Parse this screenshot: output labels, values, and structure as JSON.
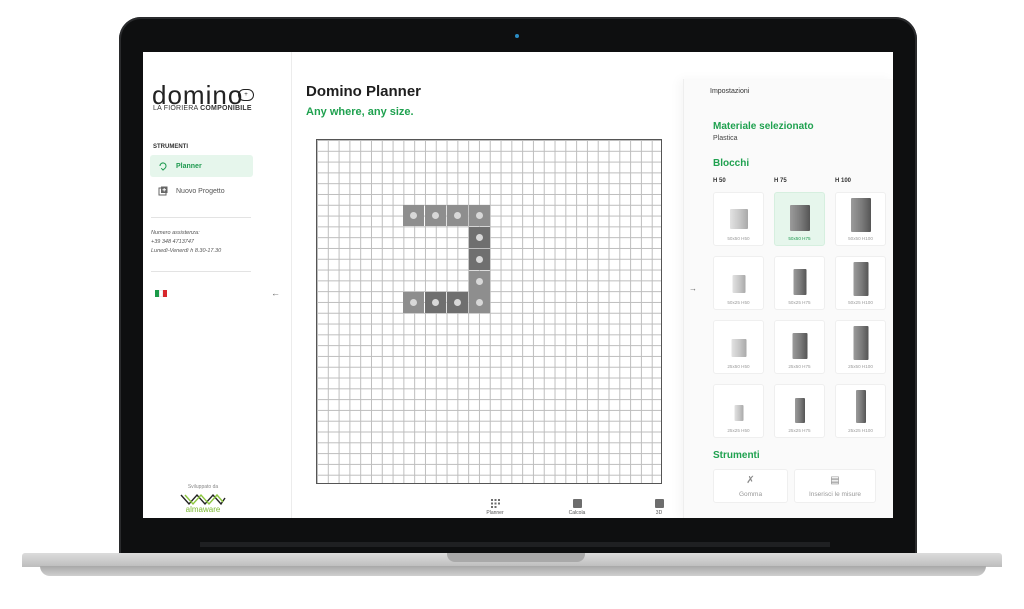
{
  "brand": {
    "logo_word": "domino",
    "logo_badge": "+",
    "tagline_light": "LA FIORIERA ",
    "tagline_bold": "COMPONIBILE"
  },
  "sidebar": {
    "section_title": "STRUMENTI",
    "items": [
      {
        "label": "Planner",
        "icon": "planner-icon",
        "active": true
      },
      {
        "label": "Nuovo Progetto",
        "icon": "new-project-icon",
        "active": false
      }
    ],
    "assistance": {
      "line1": "Numero assistenza:",
      "line2": "+39 348 4713747",
      "line3": "Lunedì-Venerdì h 8.30-17.30"
    },
    "flag_colors": [
      "#1b9a48",
      "#ffffff",
      "#d7262c"
    ],
    "collapse_icon": "arrow-left-icon",
    "developed_by": "Sviluppato da",
    "developer_name": "almaware"
  },
  "main": {
    "title": "Domino Planner",
    "subtitle": "Any where, any size.",
    "bottom_tabs": [
      {
        "label": "Planner",
        "icon": "grid-icon"
      },
      {
        "label": "Calcola",
        "icon": "calculator-icon"
      },
      {
        "label": "3D",
        "icon": "cube-icon"
      }
    ]
  },
  "panel": {
    "header": "Impostazioni",
    "material_title": "Materiale selezionato",
    "material_value": "Plastica",
    "blocks_title": "Blocchi",
    "columns": [
      "H 50",
      "H 75",
      "H 100"
    ],
    "blocks": [
      [
        "50x50 H50",
        "50x50 H75",
        "50x50 H100"
      ],
      [
        "50x25 H50",
        "50x25 H75",
        "50x25 H100"
      ],
      [
        "25x50 H50",
        "25x50 H75",
        "25x50 H100"
      ],
      [
        "25x25 H50",
        "25x25 H75",
        "25x25 H100"
      ]
    ],
    "selected_block": "50x50 H75",
    "tools_title": "Strumenti",
    "tools": [
      {
        "label": "Gomma",
        "icon": "eraser-icon"
      },
      {
        "label": "Inserisci le misure",
        "icon": "ruler-icon"
      }
    ],
    "expand_icon": "arrow-right-icon"
  },
  "colors": {
    "accent_green": "#1fa14f",
    "selected_bg": "#e6f6ec"
  }
}
